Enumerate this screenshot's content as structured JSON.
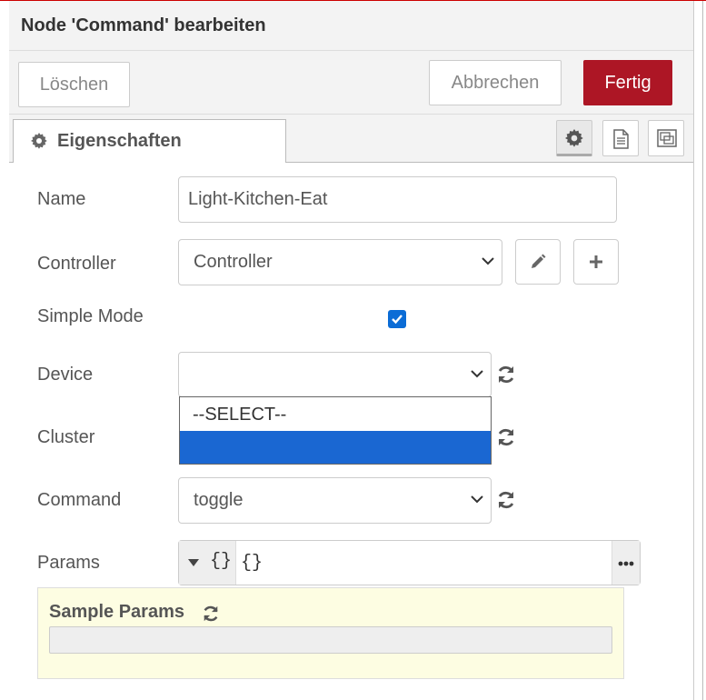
{
  "dialog": {
    "title": "Node 'Command' bearbeiten"
  },
  "toolbar": {
    "delete_label": "Löschen",
    "cancel_label": "Abbrechen",
    "done_label": "Fertig"
  },
  "tabs": [
    {
      "label": "Eigenschaften",
      "icon": "gear-icon",
      "active": true
    }
  ],
  "tab_icons": [
    "gear-icon",
    "document-icon",
    "frame-icon"
  ],
  "form": {
    "name": {
      "label": "Name",
      "value": "Light-Kitchen-Eat"
    },
    "controller": {
      "label": "Controller",
      "value": "Controller"
    },
    "simple_mode": {
      "label": "Simple Mode",
      "checked": true
    },
    "device": {
      "label": "Device",
      "value": ""
    },
    "cluster": {
      "label": "Cluster"
    },
    "command": {
      "label": "Command",
      "value": "toggle"
    },
    "params": {
      "label": "Params",
      "type_symbol": "{}",
      "value": "{}"
    }
  },
  "device_dropdown": {
    "options": [
      "--SELECT--",
      ""
    ],
    "highlighted_index": 1
  },
  "sample_params": {
    "title": "Sample Params",
    "value": ""
  },
  "colors": {
    "primary_button": "#ad1625",
    "checkbox": "#0b6cd6",
    "dropdown_highlight": "#1a67d2",
    "sample_bg": "#fdfde2"
  }
}
